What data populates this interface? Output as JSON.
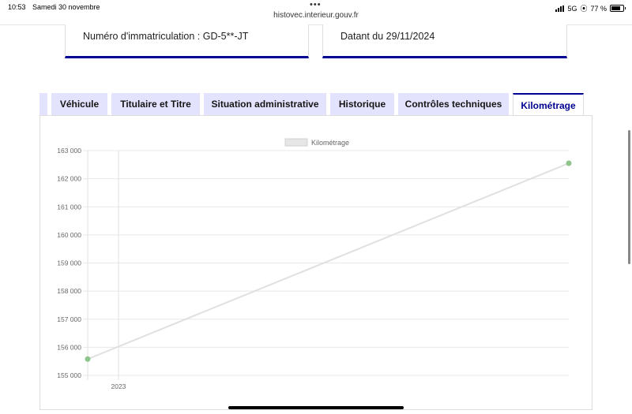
{
  "status_bar": {
    "time": "10:53",
    "date": "Samedi 30 novembre",
    "network": "5G",
    "battery": "77 %",
    "battery_level": 0.77
  },
  "browser": {
    "url": "histovec.interieur.gouv.fr"
  },
  "cards": {
    "plate": "Numéro d'immatriculation : GD-5**-JT",
    "date": "Datant du 29/11/2024"
  },
  "tabs": [
    {
      "label": "Véhicule"
    },
    {
      "label": "Titulaire et Titre"
    },
    {
      "label": "Situation administrative"
    },
    {
      "label": "Historique"
    },
    {
      "label": "Contrôles techniques"
    },
    {
      "label": "Kilométrage"
    }
  ],
  "active_tab": "Kilométrage",
  "colors": {
    "accent": "#000091",
    "tab_bg": "#e3e3fd",
    "point": "#8dc58a",
    "line": "#e0e0e0"
  },
  "chart_data": {
    "type": "line",
    "title": "",
    "xlabel": "",
    "ylabel": "",
    "legend": "Kilométrage",
    "legend_position": "top",
    "x_ticks": [
      "2023"
    ],
    "y_ticks": [
      "163 000",
      "162 000",
      "161 000",
      "160 000",
      "159 000",
      "158 000",
      "157 000",
      "156 000",
      "155 000"
    ],
    "ylim": [
      155000,
      163000
    ],
    "grid": true,
    "series": [
      {
        "name": "Kilométrage",
        "points": [
          {
            "x": 0.0,
            "y": 155580
          },
          {
            "x": 1.0,
            "y": 162550
          }
        ]
      }
    ],
    "x_tick_position": 0.064
  }
}
